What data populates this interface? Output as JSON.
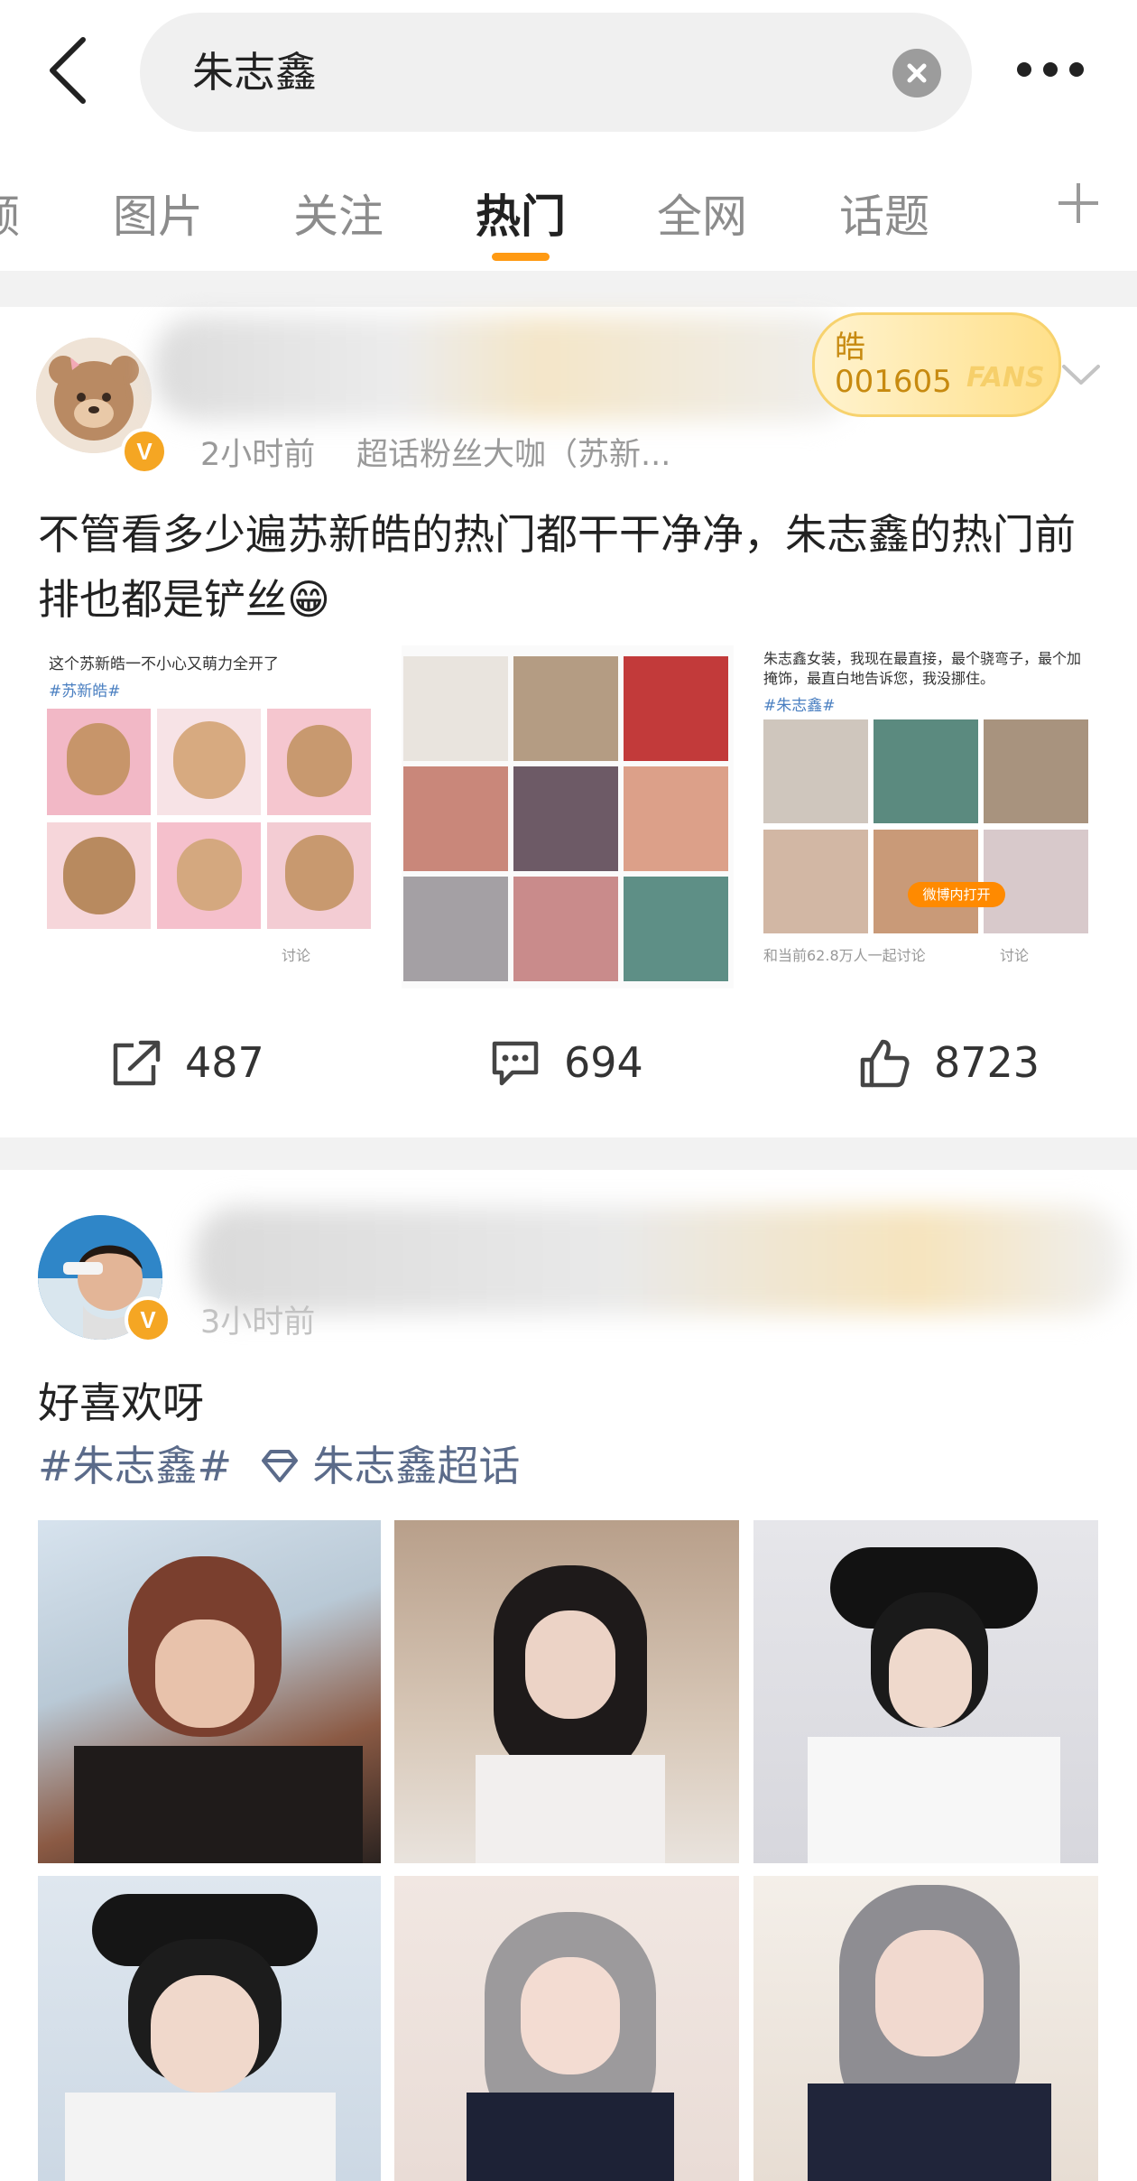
{
  "search": {
    "query": "朱志鑫"
  },
  "tabs": [
    {
      "label": "频"
    },
    {
      "label": "图片"
    },
    {
      "label": "关注"
    },
    {
      "label": "热门"
    },
    {
      "label": "全网"
    },
    {
      "label": "话题"
    }
  ],
  "active_tab": "热门",
  "post1": {
    "badge_text_1": "皓",
    "badge_text_2": "001605",
    "badge_text_3": "FANS",
    "meta": "2小时前",
    "tag": "超话粉丝大咖（苏新...",
    "text": "不管看多少遍苏新皓的热门都干干净净，朱志鑫的热门前排也都是铲丝😁",
    "images": [
      {
        "caption": "这个苏新皓一不小心又萌力全开了",
        "hashtag": "#苏新皓#",
        "footer": "讨论"
      },
      {
        "caption": "",
        "hashtag": "",
        "footer": ""
      },
      {
        "caption": "朱志鑫女装，我现在最直接，最个骁弯子，最个加掩饰，最直白地告诉您，我没挪住。",
        "hashtag": "#朱志鑫#",
        "pill": "微博内打开",
        "footer_left": "和当前62.8万人一起讨论",
        "footer": "讨论"
      }
    ],
    "actions": {
      "shares": "487",
      "comments": "694",
      "likes": "8723"
    }
  },
  "post2": {
    "meta": "3小时前",
    "text": "好喜欢呀",
    "hashtag": "#朱志鑫#",
    "supertopic": "朱志鑫超话"
  },
  "colors": {
    "accent": "#ff9a13",
    "link": "#5b6b8a",
    "badge": "#f5a623"
  }
}
